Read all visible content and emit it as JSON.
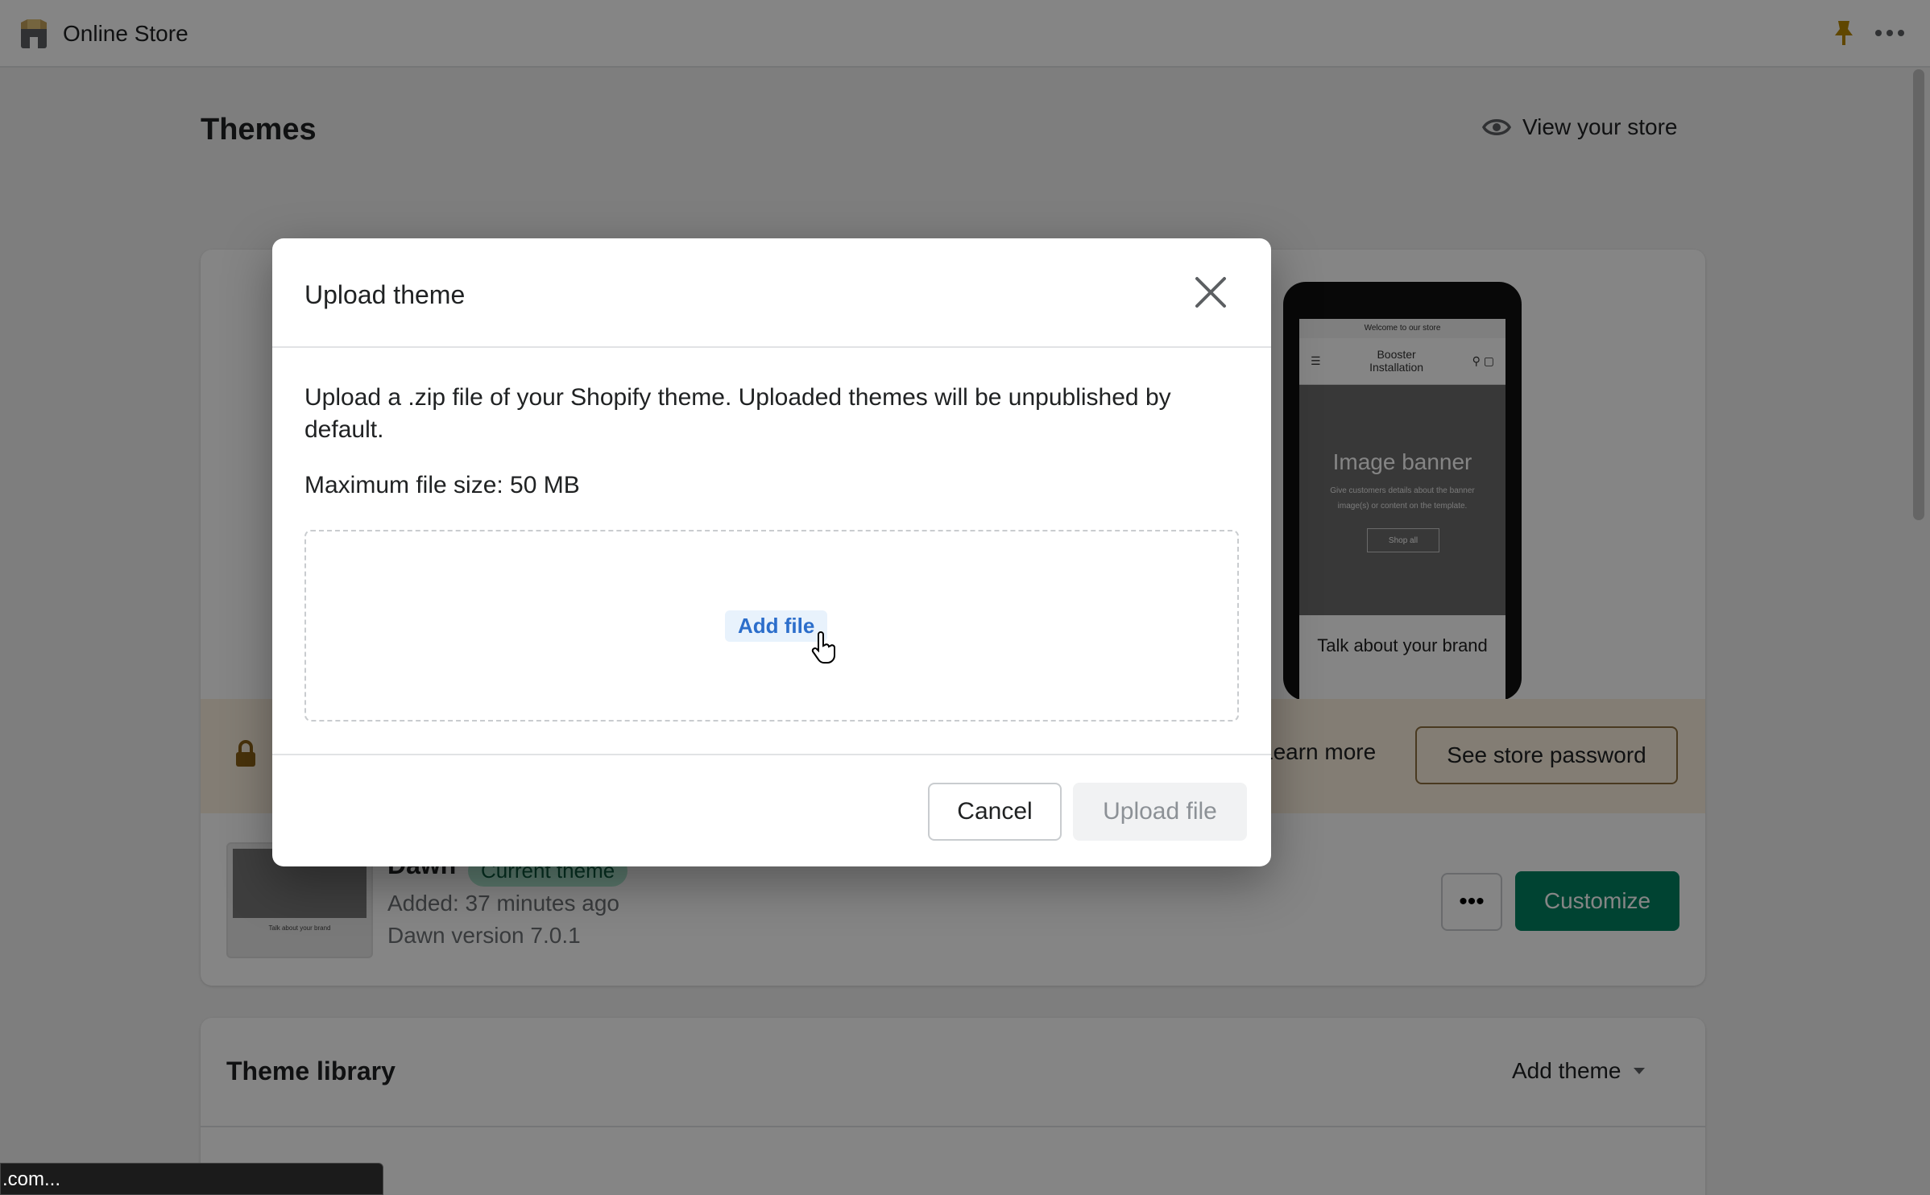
{
  "topbar": {
    "app_title": "Online Store"
  },
  "page": {
    "title": "Themes",
    "view_store_label": "View your store"
  },
  "preview": {
    "welcome_text": "Welcome to our store",
    "brand_line1": "Booster",
    "brand_line2": "Installation",
    "banner_title": "Image banner",
    "banner_sub": "Give customers details about the banner image(s) or content on the template.",
    "banner_button": "Shop all",
    "brand_text": "Talk about your brand"
  },
  "password_banner": {
    "learn_more": "Learn more",
    "see_password_label": "See store password"
  },
  "current_theme": {
    "name": "Dawn",
    "badge": "Current theme",
    "added": "Added: 37 minutes ago",
    "version": "Dawn version 7.0.1",
    "more_label": "•••",
    "customize_label": "Customize"
  },
  "library": {
    "title": "Theme library",
    "add_theme_label": "Add theme"
  },
  "modal": {
    "title": "Upload theme",
    "description": "Upload a .zip file of your Shopify theme. Uploaded themes will be unpublished by default.",
    "max_size": "Maximum file size: 50 MB",
    "add_file_label": "Add file",
    "cancel_label": "Cancel",
    "upload_label": "Upload file"
  },
  "status_bar": {
    "text": ".com..."
  },
  "colors": {
    "primary": "#008060",
    "badge_bg": "#aee9d1",
    "link": "#2c6ecb",
    "banner_bg": "#fbf0df"
  }
}
